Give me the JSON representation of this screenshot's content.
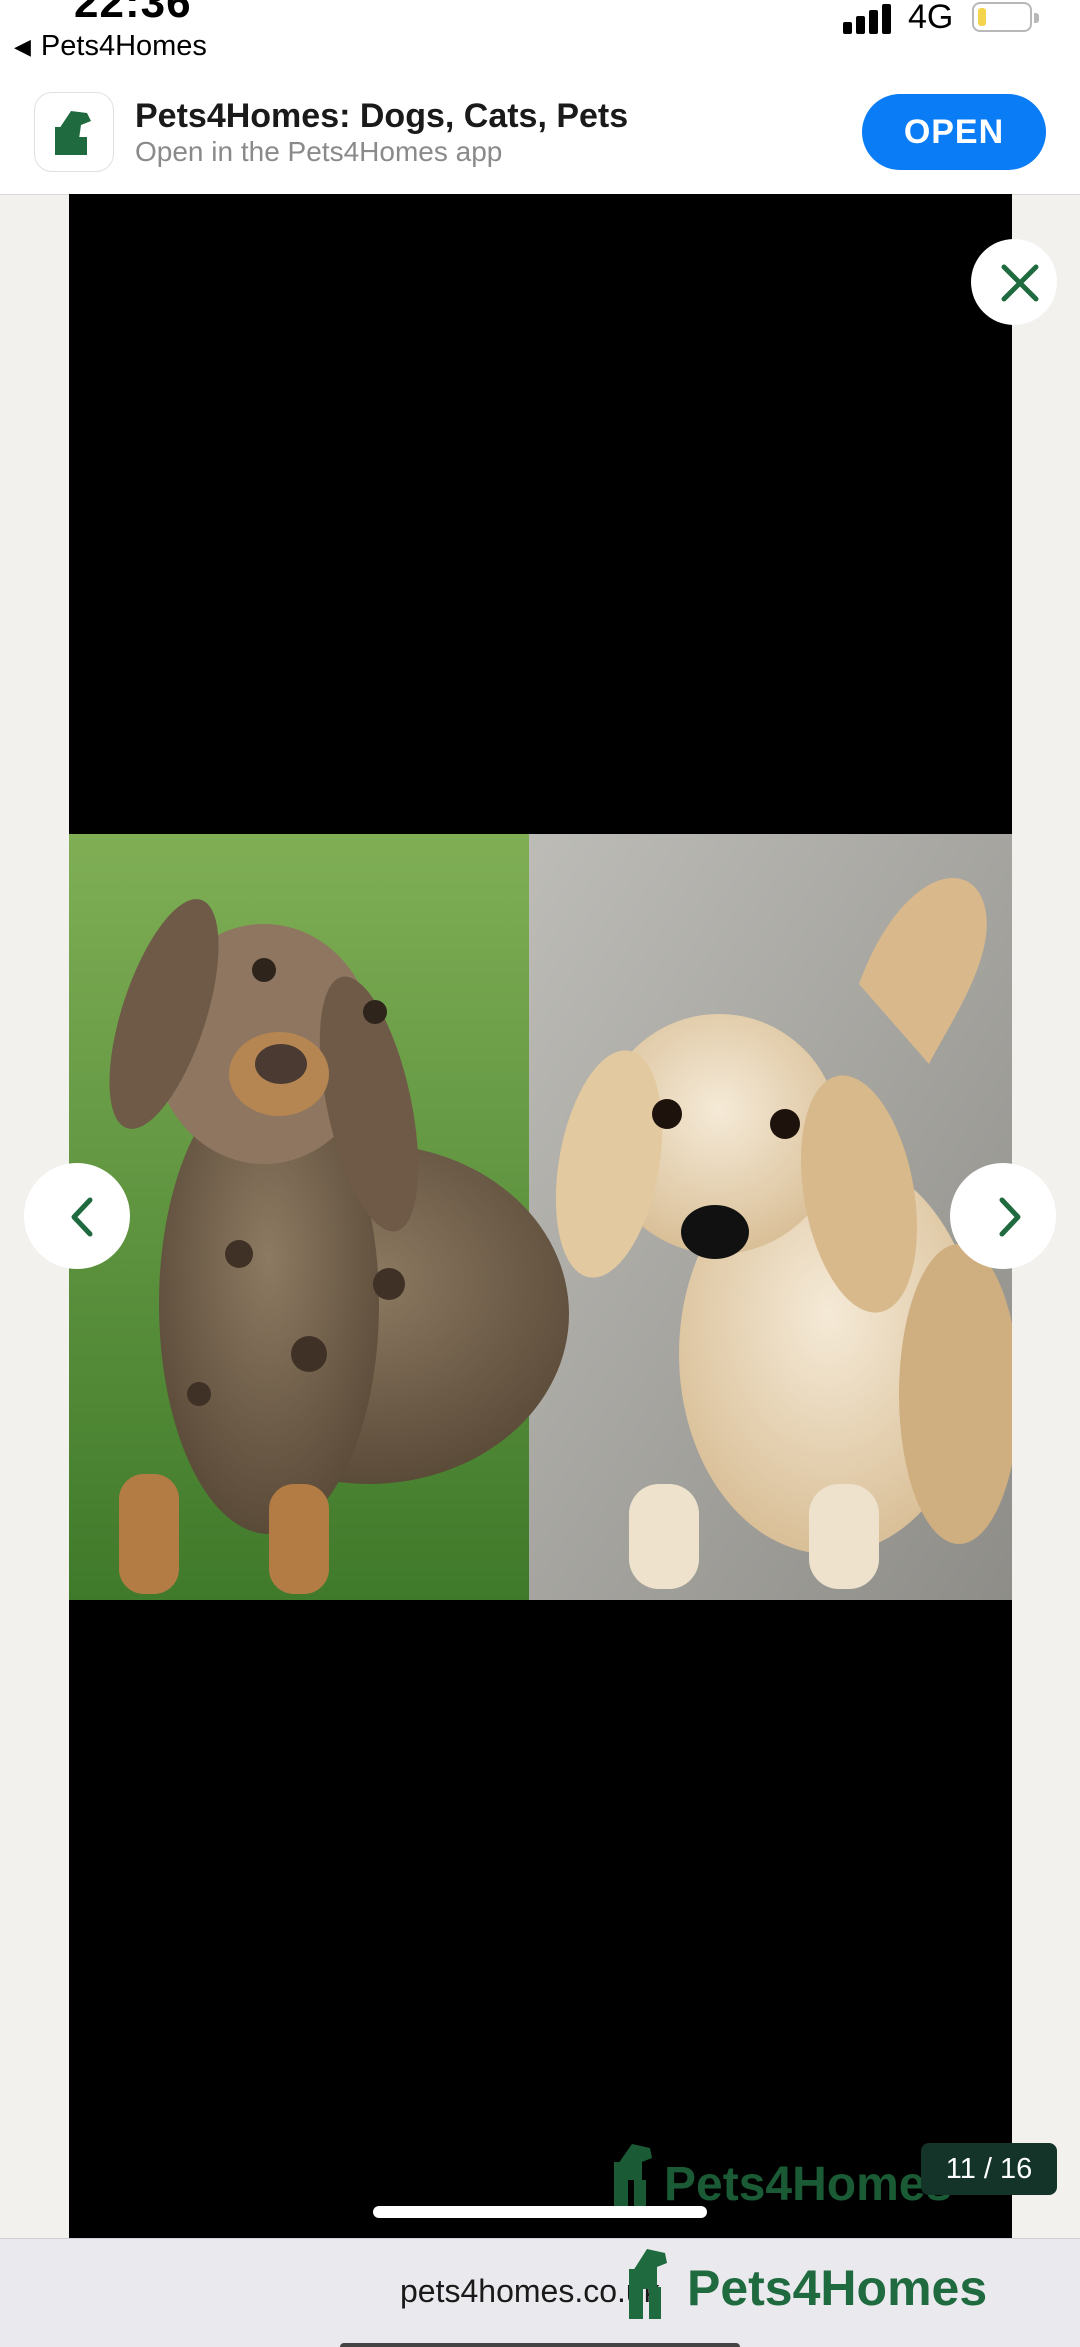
{
  "status_bar": {
    "time": "22:36",
    "back_app": "Pets4Homes",
    "network": "4G"
  },
  "app_banner": {
    "title": "Pets4Homes: Dogs, Cats, Pets",
    "subtitle": "Open in the Pets4Homes app",
    "open_label": "OPEN"
  },
  "gallery": {
    "counter": "11 / 16",
    "watermark": "Pets4Homes"
  },
  "browser": {
    "url": "pets4homes.co.uk",
    "brand": "Pets4Homes"
  },
  "colors": {
    "brand_green": "#1f6b3f",
    "banner_button": "#0a7cf5",
    "counter_bg": "#14342a"
  }
}
